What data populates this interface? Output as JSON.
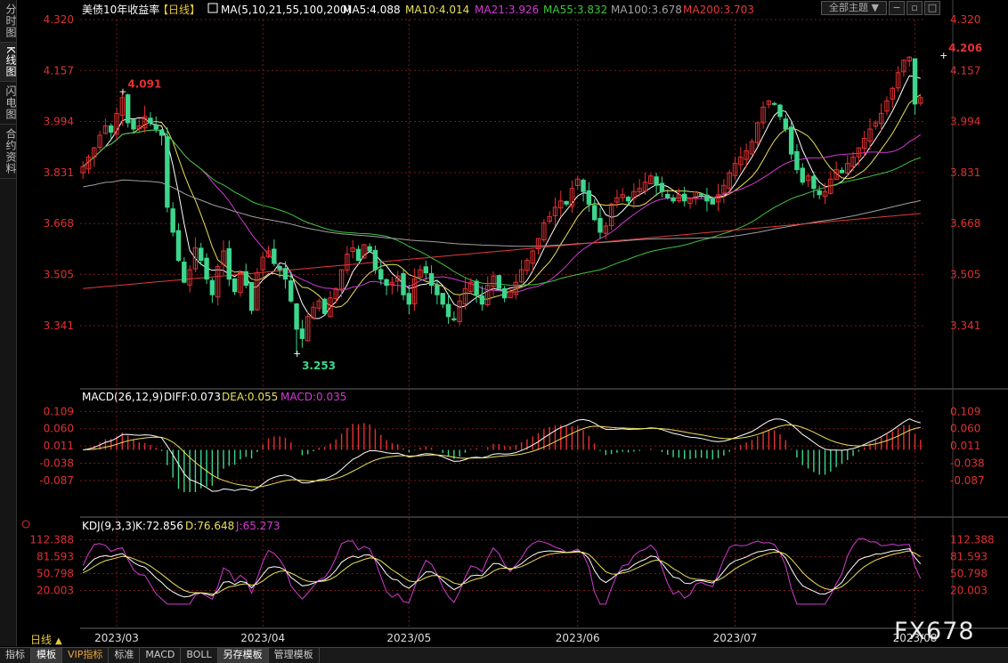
{
  "side_tabs": [
    "分时图",
    "K线图",
    "闪电图",
    "合约资料"
  ],
  "bottom_tabs": [
    "指标",
    "模板",
    "VIP指标",
    "标准",
    "MACD",
    "BOLL",
    "另存模板",
    "管理模板"
  ],
  "period_selector": "日线",
  "theme_selector": "全部主题",
  "watermark": "FX678",
  "colors": {
    "up": "#e53131",
    "down": "#3dd68c",
    "ma5": "#ffffff",
    "ma10": "#e8e05a",
    "ma21": "#d23ad2",
    "ma55": "#3ec43e",
    "ma100": "#a0a0a0",
    "ma200": "#e53a3a",
    "grid": "#7a1a1a",
    "axis_text": "#e03030",
    "diff": "#ffffff",
    "dea": "#e8e05a",
    "k": "#ffffff",
    "d": "#e8e05a",
    "j": "#d23ad2"
  },
  "main_header": {
    "title": "美债10年收益率",
    "period": "【日线】",
    "ma_label": "MA(5,10,21,55,100,200)",
    "ma5": "MA5:4.088",
    "ma10": "MA10:4.014",
    "ma21": "MA21:3.926",
    "ma55": "MA55:3.832",
    "ma100": "MA100:3.678",
    "ma200": "MA200:3.703"
  },
  "macd_header": {
    "label": "MACD(26,12,9)",
    "diff": "DIFF:0.073",
    "dea": "DEA:0.055",
    "macd": "MACD:0.035"
  },
  "kdj_header": {
    "label": "KDJ(9,3,3)",
    "k": "K:72.856",
    "d": "D:76.648",
    "j": "J:65.273"
  },
  "chart_data": {
    "type": "candlestick",
    "price_ticks": [
      4.32,
      4.157,
      3.994,
      3.831,
      3.668,
      3.505,
      3.341
    ],
    "price_tick_labels": [
      "4.320",
      "4.157",
      "3.994",
      "3.831",
      "3.668",
      "3.505",
      "3.341"
    ],
    "price_range": [
      3.23,
      4.32
    ],
    "macd_ticks": [
      0.109,
      0.06,
      0.011,
      -0.038,
      -0.087
    ],
    "macd_tick_labels": [
      "0.109",
      "0.060",
      "0.011",
      "-0.038",
      "-0.087"
    ],
    "macd_range": [
      -0.125,
      0.125
    ],
    "kdj_ticks": [
      112.388,
      81.593,
      50.798,
      20.003
    ],
    "kdj_tick_labels": [
      "112.388",
      "81.593",
      "50.798",
      "20.003"
    ],
    "kdj_range": [
      -10,
      120
    ],
    "x_labels": [
      "2023/03",
      "2023/04",
      "2023/05",
      "2023/06",
      "2023/07",
      "2023/08"
    ],
    "x_label_index": [
      6,
      32,
      58,
      88,
      116,
      148
    ],
    "annotations": [
      {
        "text": "4.091",
        "index": 7,
        "value": 4.091,
        "kind": "high"
      },
      {
        "text": "3.253",
        "index": 38,
        "value": 3.253,
        "kind": "low"
      },
      {
        "text": "4.206",
        "index": 153,
        "value": 4.206,
        "kind": "high"
      }
    ],
    "close_path": [
      3.85,
      3.88,
      3.91,
      3.95,
      3.98,
      3.96,
      4.02,
      4.07,
      3.99,
      3.97,
      3.98,
      4.01,
      3.99,
      3.97,
      3.95,
      3.72,
      3.64,
      3.55,
      3.48,
      3.52,
      3.59,
      3.55,
      3.49,
      3.44,
      3.53,
      3.58,
      3.49,
      3.45,
      3.51,
      3.47,
      3.39,
      3.51,
      3.56,
      3.58,
      3.54,
      3.52,
      3.49,
      3.42,
      3.33,
      3.3,
      3.37,
      3.4,
      3.42,
      3.38,
      3.43,
      3.46,
      3.52,
      3.57,
      3.59,
      3.55,
      3.6,
      3.58,
      3.52,
      3.49,
      3.47,
      3.48,
      3.5,
      3.44,
      3.41,
      3.49,
      3.52,
      3.51,
      3.47,
      3.44,
      3.41,
      3.37,
      3.36,
      3.42,
      3.46,
      3.48,
      3.44,
      3.41,
      3.47,
      3.5,
      3.46,
      3.43,
      3.45,
      3.48,
      3.52,
      3.55,
      3.58,
      3.62,
      3.67,
      3.69,
      3.72,
      3.74,
      3.73,
      3.78,
      3.81,
      3.77,
      3.73,
      3.68,
      3.64,
      3.66,
      3.73,
      3.75,
      3.76,
      3.74,
      3.77,
      3.78,
      3.8,
      3.82,
      3.79,
      3.77,
      3.75,
      3.74,
      3.76,
      3.74,
      3.75,
      3.77,
      3.76,
      3.74,
      3.73,
      3.76,
      3.79,
      3.83,
      3.86,
      3.88,
      3.9,
      3.93,
      3.99,
      4.04,
      4.06,
      4.05,
      4.01,
      3.97,
      3.89,
      3.84,
      3.8,
      3.82,
      3.78,
      3.76,
      3.77,
      3.81,
      3.84,
      3.83,
      3.86,
      3.88,
      3.91,
      3.94,
      3.97,
      3.99,
      4.02,
      4.06,
      4.1,
      4.15,
      4.19,
      4.2,
      4.05,
      4.07
    ]
  }
}
